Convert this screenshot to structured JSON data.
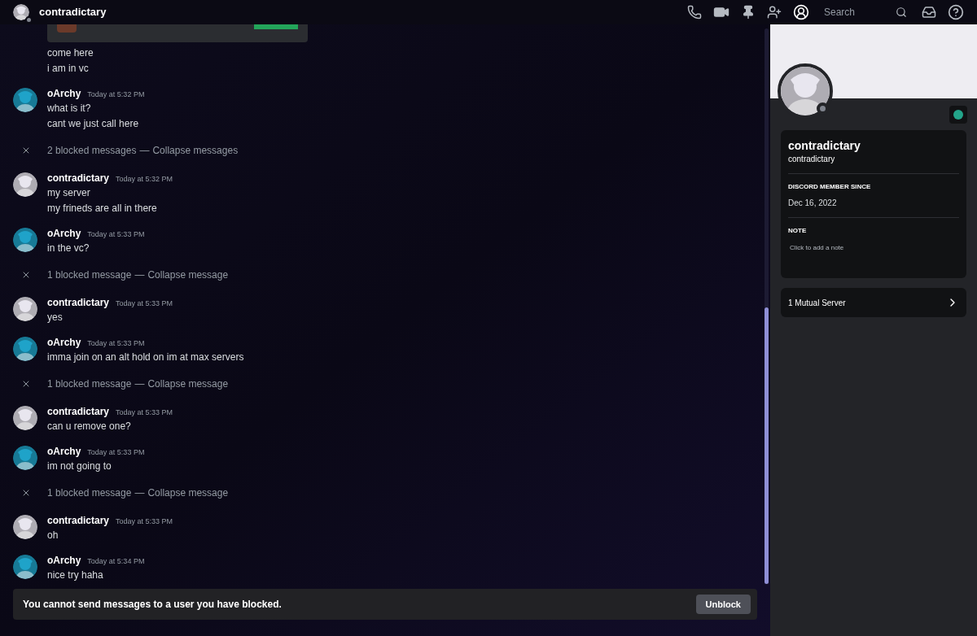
{
  "header": {
    "title": "contradictary",
    "search": {
      "placeholder": "Search"
    }
  },
  "feed": [
    {
      "kind": "embed"
    },
    {
      "kind": "continuation",
      "lines": [
        "come here",
        "i am in vc"
      ]
    },
    {
      "kind": "message",
      "author": "oArchy",
      "color": "#1fa3c9",
      "time": "Today at 5:32 PM",
      "lines": [
        "what is it?",
        "cant we just call here"
      ]
    },
    {
      "kind": "blocked",
      "text": "2 blocked messages",
      "separator": "—",
      "link": "Collapse messages"
    },
    {
      "kind": "message",
      "author": "contradictary",
      "color": "#e8e6ef",
      "time": "Today at 5:32 PM",
      "lines": [
        "my server",
        "my frineds are all in there"
      ]
    },
    {
      "kind": "message",
      "author": "oArchy",
      "color": "#1fa3c9",
      "time": "Today at 5:33 PM",
      "lines": [
        "in the vc?"
      ]
    },
    {
      "kind": "blocked",
      "text": "1 blocked message",
      "separator": "—",
      "link": "Collapse message"
    },
    {
      "kind": "message",
      "author": "contradictary",
      "color": "#e8e6ef",
      "time": "Today at 5:33 PM",
      "lines": [
        "yes"
      ]
    },
    {
      "kind": "message",
      "author": "oArchy",
      "color": "#1fa3c9",
      "time": "Today at 5:33 PM",
      "lines": [
        "imma join on an alt hold on im at max servers"
      ]
    },
    {
      "kind": "blocked",
      "text": "1 blocked message",
      "separator": "—",
      "link": "Collapse message"
    },
    {
      "kind": "message",
      "author": "contradictary",
      "color": "#e8e6ef",
      "time": "Today at 5:33 PM",
      "lines": [
        "can u remove one?"
      ]
    },
    {
      "kind": "message",
      "author": "oArchy",
      "color": "#1fa3c9",
      "time": "Today at 5:33 PM",
      "lines": [
        "im not going to"
      ]
    },
    {
      "kind": "blocked",
      "text": "1 blocked message",
      "separator": "—",
      "link": "Collapse message"
    },
    {
      "kind": "message",
      "author": "contradictary",
      "color": "#e8e6ef",
      "time": "Today at 5:33 PM",
      "lines": [
        "oh"
      ]
    },
    {
      "kind": "message",
      "author": "oArchy",
      "color": "#1fa3c9",
      "time": "Today at 5:34 PM",
      "lines": [
        "nice try haha"
      ]
    }
  ],
  "blocked_bar": {
    "text": "You cannot send messages to a user you have blocked.",
    "button": "Unblock"
  },
  "profile": {
    "display_name": "contradictary",
    "username": "contradictary",
    "member_since_label": "DISCORD MEMBER SINCE",
    "member_since": "Dec 16, 2022",
    "note_label": "NOTE",
    "note_placeholder": "Click to add a note",
    "mutual": "1 Mutual Server"
  }
}
